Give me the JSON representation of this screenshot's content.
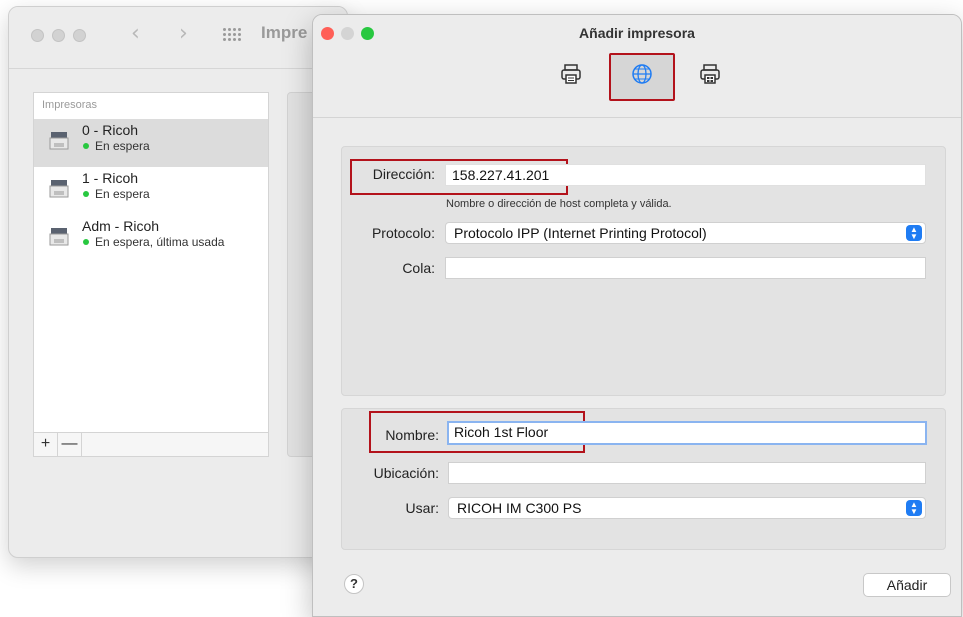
{
  "back_window": {
    "title": "Impre",
    "list_header": "Impresoras",
    "printers": [
      {
        "name": "0 - Ricoh",
        "status": "En espera"
      },
      {
        "name": "1 - Ricoh",
        "status": "En espera"
      },
      {
        "name": "Adm - Ricoh",
        "status": "En espera, última usada"
      }
    ],
    "add_label": "+",
    "remove_label": "—"
  },
  "dialog": {
    "title": "Añadir impresora",
    "toolbar": {
      "tabs": [
        "default-printer-icon",
        "ip-globe-icon",
        "windows-printer-icon"
      ],
      "selected_tab": "ip-globe-icon"
    },
    "address": {
      "label": "Dirección:",
      "value": "158.227.41.201",
      "hint": "Nombre o dirección de host completa y válida."
    },
    "protocol": {
      "label": "Protocolo:",
      "value": "Protocolo IPP (Internet Printing Protocol)"
    },
    "queue": {
      "label": "Cola:",
      "value": ""
    },
    "name": {
      "label": "Nombre:",
      "value": "Ricoh 1st Floor"
    },
    "location": {
      "label": "Ubicación:",
      "value": ""
    },
    "use": {
      "label": "Usar:",
      "value": "RICOH IM C300 PS"
    },
    "help_label": "?",
    "add_label": "Añadir"
  },
  "colors": {
    "accent": "#1f7cf3",
    "highlight_red": "#b3121b",
    "status_green": "#28c840",
    "close_red": "#ff5f57",
    "minimize_yellow": "#febc2e",
    "zoom_green": "#28c840"
  }
}
